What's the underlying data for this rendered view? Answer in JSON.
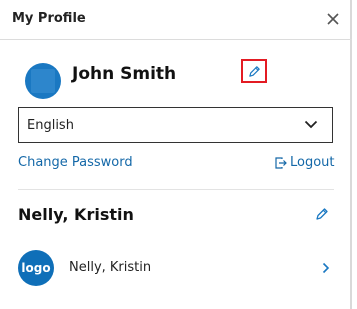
{
  "header": {
    "title": "My Profile"
  },
  "profile": {
    "name": "John Smith"
  },
  "language": {
    "selected": "English"
  },
  "links": {
    "change_password": "Change Password",
    "logout": "Logout"
  },
  "section": {
    "title": "Nelly, Kristin"
  },
  "account": {
    "logo_text": "logo",
    "name": "Nelly, Kristin"
  },
  "colors": {
    "link": "#1468a8",
    "accent": "#1a78c2",
    "highlight": "#e31b23"
  },
  "icons": [
    "close-icon",
    "pencil-icon",
    "chevron-down-icon",
    "logout-icon",
    "chevron-right-icon"
  ]
}
